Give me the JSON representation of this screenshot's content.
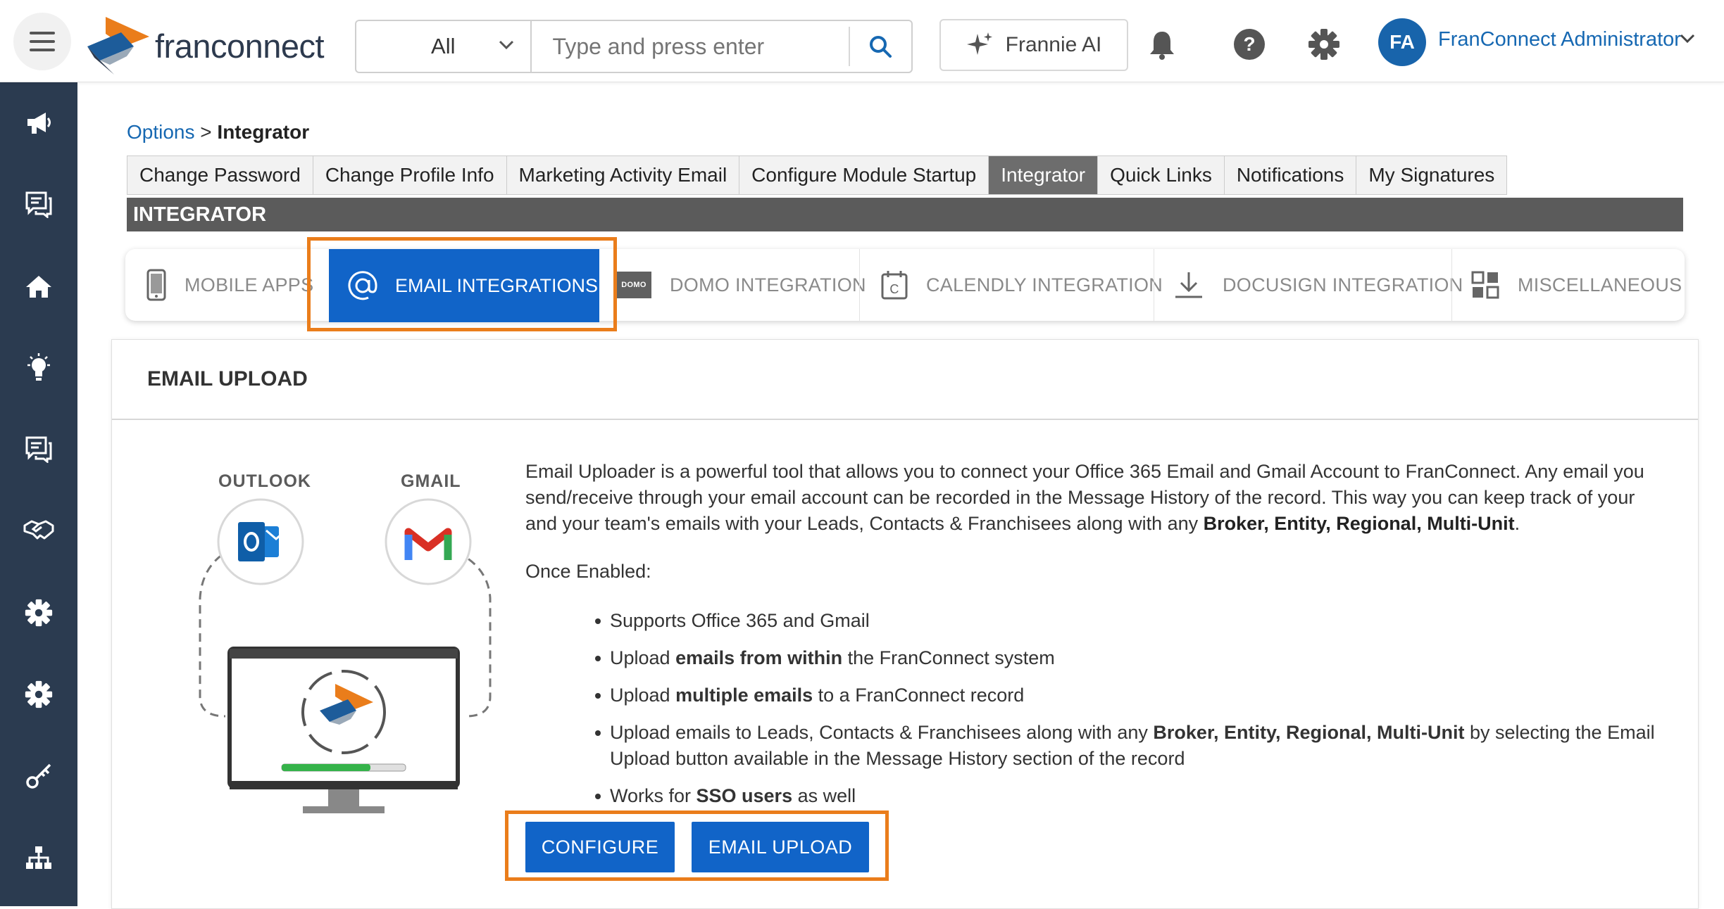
{
  "header": {
    "logo_text": "franconnect",
    "search": {
      "scope": "All",
      "placeholder": "Type and press enter"
    },
    "frannie_label": "Frannie AI",
    "avatar_initials": "FA",
    "user_name": "FranConnect Administrator"
  },
  "sidebar": {
    "items": [
      "megaphone-icon",
      "chat-icon",
      "home-icon",
      "lightbulb-icon",
      "messages-icon",
      "handshake-icon",
      "gear-icon",
      "gear-alt-icon",
      "key-icon",
      "org-chart-icon"
    ]
  },
  "breadcrumb": {
    "parent": "Options",
    "separator": ">",
    "current": "Integrator"
  },
  "tabs": [
    "Change Password",
    "Change Profile Info",
    "Marketing Activity Email",
    "Configure Module Startup",
    "Integrator",
    "Quick Links",
    "Notifications",
    "My Signatures"
  ],
  "active_tab": "Integrator",
  "section_title": "INTEGRATOR",
  "integration_tabs": {
    "mobile": "MOBILE APPS",
    "email": "EMAIL INTEGRATIONS",
    "domo": "DOMO INTEGRATION",
    "calendly": "CALENDLY INTEGRATION",
    "docusign": "DOCUSIGN INTEGRATION",
    "misc": "MISCELLANEOUS",
    "domo_logo": "DOMO"
  },
  "card": {
    "title": "EMAIL UPLOAD",
    "illustration": {
      "outlook": "OUTLOOK",
      "gmail": "GMAIL"
    },
    "desc_main": "Email Uploader is a powerful tool that allows you to connect your Office 365 Email and Gmail Account to FranConnect. Any email you send/receive through your email account can be recorded in the Message History of the record. This way you can keep track of your and your team's emails with your Leads, Contacts & Franchisees along with any ",
    "desc_bold": "Broker, Entity, Regional, Multi-Unit",
    "desc_end": ".",
    "once_enabled": "Once Enabled:",
    "bullets": {
      "b1": "Supports Office 365 and Gmail",
      "b2_pre": "Upload ",
      "b2_bold": "emails from within",
      "b2_post": " the FranConnect system",
      "b3_pre": "Upload ",
      "b3_bold": "multiple emails",
      "b3_post": " to a FranConnect record",
      "b4_pre": "Upload emails to Leads, Contacts & Franchisees along with any ",
      "b4_bold": "Broker, Entity, Regional, Multi-Unit",
      "b4_post": " by selecting the Email Upload button available in the Message History section of the record",
      "b5_pre": "Works for ",
      "b5_bold": "SSO users",
      "b5_post": " as well"
    },
    "buttons": {
      "configure": "CONFIGURE",
      "email_upload": "EMAIL UPLOAD"
    }
  },
  "colors": {
    "accent": "#1164c8",
    "highlight": "#ea7d1b",
    "sidebar": "#2b3b50",
    "section_bar": "#5b5b5b"
  }
}
